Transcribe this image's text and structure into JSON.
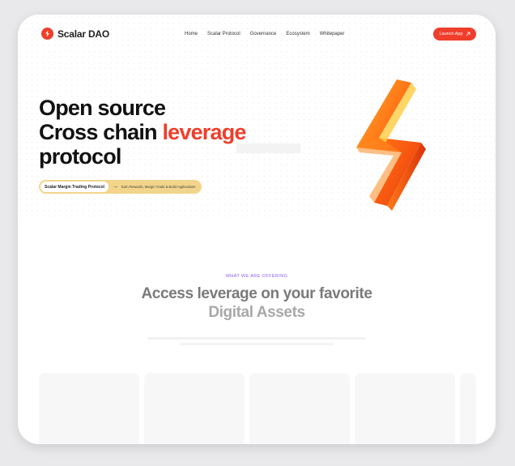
{
  "brand": {
    "name": "Scalar DAO"
  },
  "nav": {
    "items": [
      "Home",
      "Scalar Protocol",
      "Governance",
      "Ecosystem",
      "Whitepaper"
    ],
    "launch_label": "Launch App",
    "launch_icon": "arrow-up-right-icon"
  },
  "hero": {
    "line1": "Open source",
    "line2_prefix": "Cross chain ",
    "line2_accent": "leverage",
    "line3": "protocol",
    "pill_tag": "Scalar Margin Trading Protocol",
    "pill_arrow": "→",
    "pill_text": "Earn Rewards, Margin Trade & Build Applications"
  },
  "section": {
    "eyebrow": "WHAT WE ARE OFFERING",
    "title_line1": "Access leverage on your favorite",
    "title_line2": "Digital Assets"
  },
  "colors": {
    "accent": "#ef3e2b",
    "pill": "#f2d58b",
    "eyebrow": "#8a5cf5"
  }
}
